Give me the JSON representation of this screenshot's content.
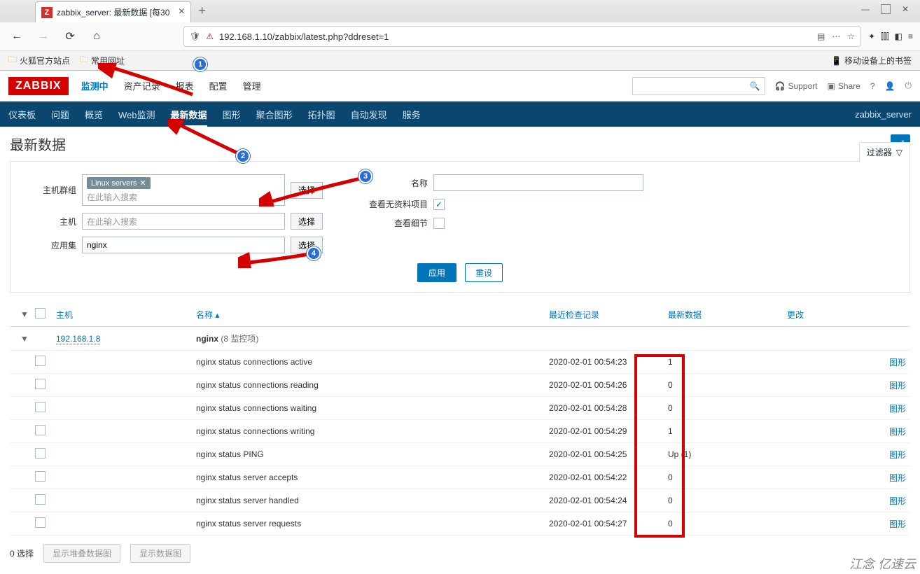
{
  "browser": {
    "tab_title": "zabbix_server: 最新数据 [每30",
    "url": "192.168.1.10/zabbix/latest.php?ddreset=1",
    "bookmarks": {
      "firefox": "火狐官方站点",
      "common": "常用网址",
      "mobile": "移动设备上的书签"
    }
  },
  "zabbix": {
    "logo": "ZABBIX",
    "top_menu": [
      "监测中",
      "资产记录",
      "报表",
      "配置",
      "管理"
    ],
    "top_menu_active": 0,
    "support": "Support",
    "share": "Share",
    "sub_menu": [
      "仪表板",
      "问题",
      "概览",
      "Web监测",
      "最新数据",
      "图形",
      "聚合图形",
      "拓扑图",
      "自动发现",
      "服务"
    ],
    "sub_menu_active": 4,
    "host_label": "zabbix_server",
    "page_title": "最新数据",
    "filter_label": "过滤器"
  },
  "filter": {
    "hostgroup_label": "主机群组",
    "hostgroup_chip": "Linux servers",
    "hostgroup_placeholder": "在此输入搜索",
    "host_label": "主机",
    "host_placeholder": "在此输入搜索",
    "app_label": "应用集",
    "app_value": "nginx",
    "select_btn": "选择",
    "name_label": "名称",
    "show_no_data_label": "查看无资料项目",
    "show_details_label": "查看细节",
    "apply": "应用",
    "reset": "重设"
  },
  "table": {
    "headers": {
      "host": "主机",
      "name": "名称",
      "last_check": "最近检查记录",
      "last_data": "最新数据",
      "change": "更改"
    },
    "group": {
      "host": "192.168.1.8",
      "app": "nginx",
      "count_label": "(8 监控项)"
    },
    "action_label": "图形",
    "rows": [
      {
        "name": "nginx status connections active",
        "last_check": "2020-02-01 00:54:23",
        "last_data": "1"
      },
      {
        "name": "nginx status connections reading",
        "last_check": "2020-02-01 00:54:26",
        "last_data": "0"
      },
      {
        "name": "nginx status connections waiting",
        "last_check": "2020-02-01 00:54:28",
        "last_data": "0"
      },
      {
        "name": "nginx status connections writing",
        "last_check": "2020-02-01 00:54:29",
        "last_data": "1"
      },
      {
        "name": "nginx status PING",
        "last_check": "2020-02-01 00:54:25",
        "last_data": "Up (1)"
      },
      {
        "name": "nginx status server accepts",
        "last_check": "2020-02-01 00:54:22",
        "last_data": "0"
      },
      {
        "name": "nginx status server handled",
        "last_check": "2020-02-01 00:54:24",
        "last_data": "0"
      },
      {
        "name": "nginx status server requests",
        "last_check": "2020-02-01 00:54:27",
        "last_data": "0"
      }
    ]
  },
  "footer": {
    "selected": "0 选择",
    "stacked_graph": "显示堆叠数据图",
    "data_graph": "显示数据图"
  },
  "watermark": "江念 亿速云"
}
